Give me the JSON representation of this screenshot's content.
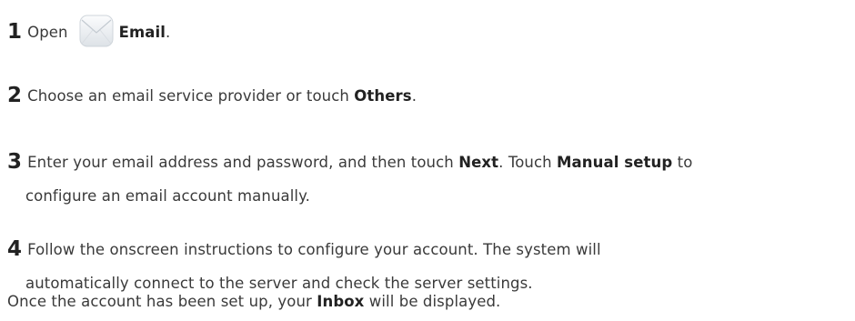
{
  "steps": [
    {
      "number": "1",
      "before": "Open",
      "icon": "email-app-icon",
      "bold": "Email",
      "after": "."
    },
    {
      "number": "2",
      "before": "Choose an email service provider or touch ",
      "bold": "Others",
      "after": "."
    },
    {
      "number": "3",
      "before": "Enter your email address and password, and then touch ",
      "bold1": "Next",
      "middle": ". Touch ",
      "bold2": "Manual setup",
      "after_line1": " to",
      "line2": "configure an email account manually."
    },
    {
      "number": "4",
      "line1": "Follow the onscreen instructions to configure your account. The system will",
      "line2": "automatically connect to the server and check the server settings."
    }
  ],
  "closing": {
    "before": "Once the account has been set up, your ",
    "bold": "Inbox",
    "after": " will be displayed."
  },
  "colors": {
    "text": "#3a3a3a",
    "bold_text": "#222222",
    "icon_light": "#f4f6f8",
    "icon_dark": "#c9cfd6"
  }
}
